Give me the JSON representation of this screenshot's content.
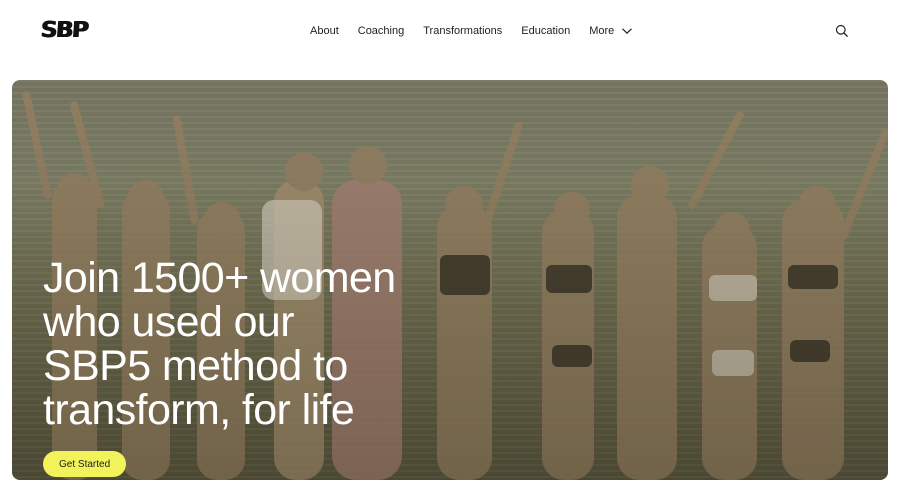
{
  "header": {
    "logo_text": "SBP",
    "nav": [
      {
        "label": "About"
      },
      {
        "label": "Coaching"
      },
      {
        "label": "Transformations"
      },
      {
        "label": "Education"
      },
      {
        "label": "More"
      }
    ],
    "search_icon": "search-icon"
  },
  "hero": {
    "title_lines": [
      "Join 1500+ women",
      "who used our",
      "SBP5 method to",
      "transform, for life"
    ],
    "cta_label": "Get Started",
    "cta_color": "#f2f25a"
  }
}
